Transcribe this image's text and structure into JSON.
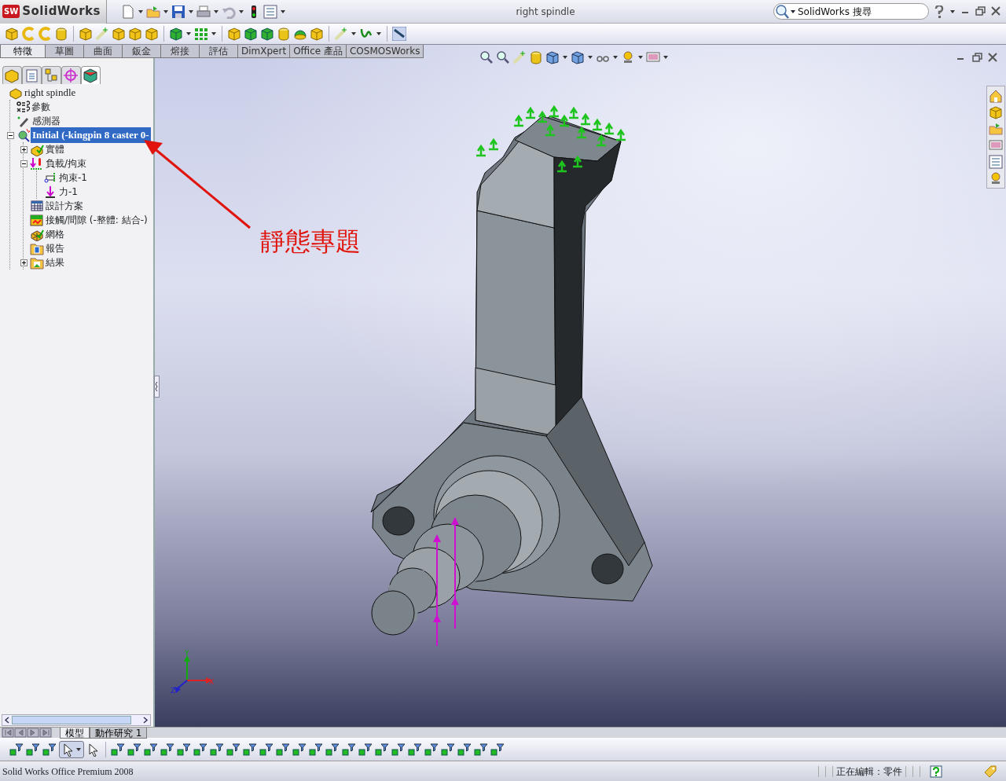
{
  "app": {
    "logo_badge": "SW",
    "logo": "SolidWorks"
  },
  "window": {
    "title": "right spindle"
  },
  "search": {
    "placeholder": "SolidWorks 搜尋"
  },
  "command_tabs": [
    {
      "label": "特徵",
      "selected": true
    },
    {
      "label": "草圖",
      "selected": false
    },
    {
      "label": "曲面",
      "selected": false
    },
    {
      "label": "鈑金",
      "selected": false
    },
    {
      "label": "熔接",
      "selected": false
    },
    {
      "label": "評估",
      "selected": false
    },
    {
      "label": "DimXpert",
      "selected": false
    },
    {
      "label": "Office 產品",
      "selected": false
    },
    {
      "label": "COSMOSWorks",
      "selected": false
    }
  ],
  "panel_tabs": [
    {
      "selected": false
    },
    {
      "selected": false
    },
    {
      "selected": false
    },
    {
      "selected": false
    },
    {
      "selected": true
    }
  ],
  "feature_tree": {
    "root": "right spindle",
    "items": [
      {
        "label": "參數",
        "selected": false
      },
      {
        "label": "感測器",
        "selected": false
      },
      {
        "label": "Initial (-kingpin 8 caster 0-",
        "selected": true,
        "expanded": true,
        "children": [
          {
            "label": "實體",
            "selected": false,
            "expanded": false
          },
          {
            "label": "負載/拘束",
            "selected": false,
            "expanded": true,
            "children": [
              {
                "label": "拘束-1",
                "selected": false
              },
              {
                "label": "力-1",
                "selected": false
              }
            ]
          },
          {
            "label": "設計方案",
            "selected": false
          },
          {
            "label": "接觸/間隙 (-整體: 結合-)",
            "selected": false
          },
          {
            "label": "網格",
            "selected": false
          },
          {
            "label": "報告",
            "selected": false
          },
          {
            "label": "結果",
            "selected": false,
            "expanded": false
          }
        ]
      }
    ]
  },
  "annotation": {
    "text": "靜態專題"
  },
  "triad": {
    "x": "X",
    "y": "Y",
    "z": "Z"
  },
  "bottom_tabs": [
    {
      "label": "模型",
      "selected": true
    },
    {
      "label": "動作研究 1",
      "selected": false
    }
  ],
  "status_bar": {
    "product": "Solid Works Office Premium 2008",
    "mode": "正在編輯：零件"
  }
}
